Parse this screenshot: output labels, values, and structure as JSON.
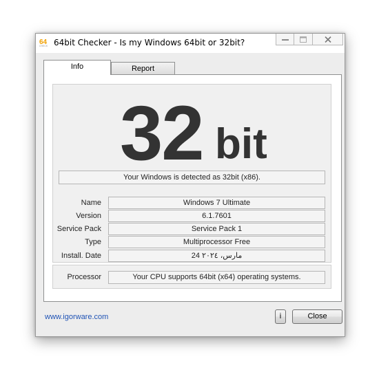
{
  "window": {
    "title": "64bit Checker - Is my Windows 64bit or 32bit?",
    "icon": "app-64-icon"
  },
  "tabs": [
    {
      "label": "Info",
      "active": true
    },
    {
      "label": "Report",
      "active": false
    }
  ],
  "result": {
    "number": "32",
    "unit": "bit",
    "detected_text": "Your Windows is detected as 32bit (x86)."
  },
  "info_fields": [
    {
      "label": "Name",
      "value": "Windows 7 Ultimate"
    },
    {
      "label": "Version",
      "value": "6.1.7601"
    },
    {
      "label": "Service Pack",
      "value": "Service Pack 1"
    },
    {
      "label": "Type",
      "value": "Multiprocessor Free"
    },
    {
      "label": "Install. Date",
      "value": "مارس، ٢٠٢٤ 24"
    }
  ],
  "processor": {
    "label": "Processor",
    "value": "Your CPU supports 64bit (x64) operating systems."
  },
  "footer": {
    "link": "www.igorware.com",
    "info_button": "i",
    "close_button": "Close"
  },
  "colors": {
    "big_text": "#333333",
    "link": "#1f53b5",
    "icon_orange": "#f0a000"
  }
}
